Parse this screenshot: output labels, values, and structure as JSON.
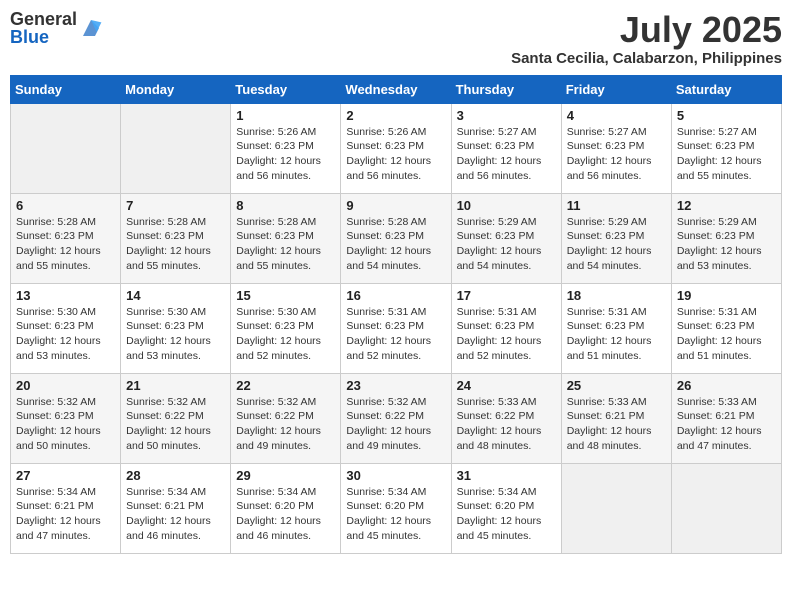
{
  "header": {
    "logo_general": "General",
    "logo_blue": "Blue",
    "month_title": "July 2025",
    "subtitle": "Santa Cecilia, Calabarzon, Philippines"
  },
  "days_of_week": [
    "Sunday",
    "Monday",
    "Tuesday",
    "Wednesday",
    "Thursday",
    "Friday",
    "Saturday"
  ],
  "weeks": [
    [
      {
        "day": "",
        "info": ""
      },
      {
        "day": "",
        "info": ""
      },
      {
        "day": "1",
        "info": "Sunrise: 5:26 AM\nSunset: 6:23 PM\nDaylight: 12 hours and 56 minutes."
      },
      {
        "day": "2",
        "info": "Sunrise: 5:26 AM\nSunset: 6:23 PM\nDaylight: 12 hours and 56 minutes."
      },
      {
        "day": "3",
        "info": "Sunrise: 5:27 AM\nSunset: 6:23 PM\nDaylight: 12 hours and 56 minutes."
      },
      {
        "day": "4",
        "info": "Sunrise: 5:27 AM\nSunset: 6:23 PM\nDaylight: 12 hours and 56 minutes."
      },
      {
        "day": "5",
        "info": "Sunrise: 5:27 AM\nSunset: 6:23 PM\nDaylight: 12 hours and 55 minutes."
      }
    ],
    [
      {
        "day": "6",
        "info": "Sunrise: 5:28 AM\nSunset: 6:23 PM\nDaylight: 12 hours and 55 minutes."
      },
      {
        "day": "7",
        "info": "Sunrise: 5:28 AM\nSunset: 6:23 PM\nDaylight: 12 hours and 55 minutes."
      },
      {
        "day": "8",
        "info": "Sunrise: 5:28 AM\nSunset: 6:23 PM\nDaylight: 12 hours and 55 minutes."
      },
      {
        "day": "9",
        "info": "Sunrise: 5:28 AM\nSunset: 6:23 PM\nDaylight: 12 hours and 54 minutes."
      },
      {
        "day": "10",
        "info": "Sunrise: 5:29 AM\nSunset: 6:23 PM\nDaylight: 12 hours and 54 minutes."
      },
      {
        "day": "11",
        "info": "Sunrise: 5:29 AM\nSunset: 6:23 PM\nDaylight: 12 hours and 54 minutes."
      },
      {
        "day": "12",
        "info": "Sunrise: 5:29 AM\nSunset: 6:23 PM\nDaylight: 12 hours and 53 minutes."
      }
    ],
    [
      {
        "day": "13",
        "info": "Sunrise: 5:30 AM\nSunset: 6:23 PM\nDaylight: 12 hours and 53 minutes."
      },
      {
        "day": "14",
        "info": "Sunrise: 5:30 AM\nSunset: 6:23 PM\nDaylight: 12 hours and 53 minutes."
      },
      {
        "day": "15",
        "info": "Sunrise: 5:30 AM\nSunset: 6:23 PM\nDaylight: 12 hours and 52 minutes."
      },
      {
        "day": "16",
        "info": "Sunrise: 5:31 AM\nSunset: 6:23 PM\nDaylight: 12 hours and 52 minutes."
      },
      {
        "day": "17",
        "info": "Sunrise: 5:31 AM\nSunset: 6:23 PM\nDaylight: 12 hours and 52 minutes."
      },
      {
        "day": "18",
        "info": "Sunrise: 5:31 AM\nSunset: 6:23 PM\nDaylight: 12 hours and 51 minutes."
      },
      {
        "day": "19",
        "info": "Sunrise: 5:31 AM\nSunset: 6:23 PM\nDaylight: 12 hours and 51 minutes."
      }
    ],
    [
      {
        "day": "20",
        "info": "Sunrise: 5:32 AM\nSunset: 6:23 PM\nDaylight: 12 hours and 50 minutes."
      },
      {
        "day": "21",
        "info": "Sunrise: 5:32 AM\nSunset: 6:22 PM\nDaylight: 12 hours and 50 minutes."
      },
      {
        "day": "22",
        "info": "Sunrise: 5:32 AM\nSunset: 6:22 PM\nDaylight: 12 hours and 49 minutes."
      },
      {
        "day": "23",
        "info": "Sunrise: 5:32 AM\nSunset: 6:22 PM\nDaylight: 12 hours and 49 minutes."
      },
      {
        "day": "24",
        "info": "Sunrise: 5:33 AM\nSunset: 6:22 PM\nDaylight: 12 hours and 48 minutes."
      },
      {
        "day": "25",
        "info": "Sunrise: 5:33 AM\nSunset: 6:21 PM\nDaylight: 12 hours and 48 minutes."
      },
      {
        "day": "26",
        "info": "Sunrise: 5:33 AM\nSunset: 6:21 PM\nDaylight: 12 hours and 47 minutes."
      }
    ],
    [
      {
        "day": "27",
        "info": "Sunrise: 5:34 AM\nSunset: 6:21 PM\nDaylight: 12 hours and 47 minutes."
      },
      {
        "day": "28",
        "info": "Sunrise: 5:34 AM\nSunset: 6:21 PM\nDaylight: 12 hours and 46 minutes."
      },
      {
        "day": "29",
        "info": "Sunrise: 5:34 AM\nSunset: 6:20 PM\nDaylight: 12 hours and 46 minutes."
      },
      {
        "day": "30",
        "info": "Sunrise: 5:34 AM\nSunset: 6:20 PM\nDaylight: 12 hours and 45 minutes."
      },
      {
        "day": "31",
        "info": "Sunrise: 5:34 AM\nSunset: 6:20 PM\nDaylight: 12 hours and 45 minutes."
      },
      {
        "day": "",
        "info": ""
      },
      {
        "day": "",
        "info": ""
      }
    ]
  ]
}
